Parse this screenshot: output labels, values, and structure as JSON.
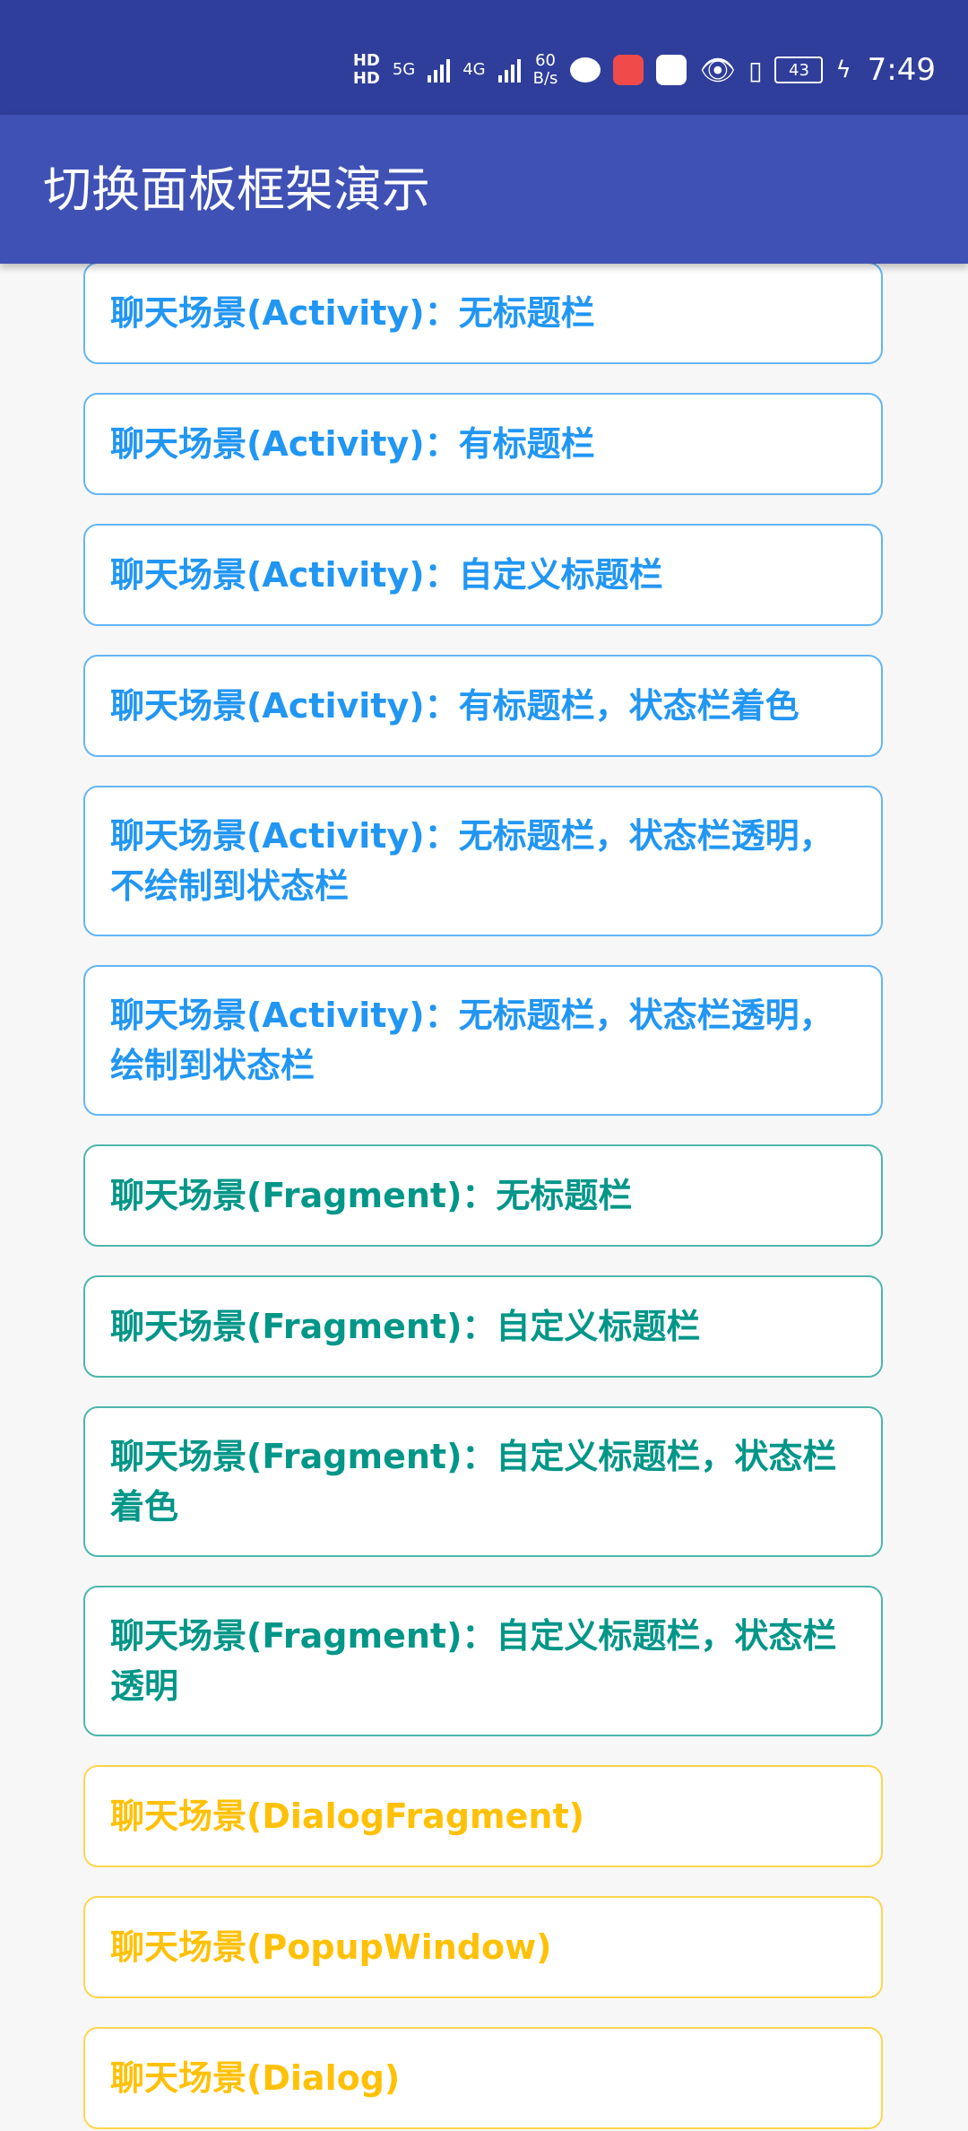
{
  "status_bar": {
    "hd_top": "HD",
    "hd_bottom": "HD",
    "net_5g": "5G",
    "net_4g": "4G",
    "speed_value": "60",
    "speed_unit": "B/s",
    "battery": "43",
    "time": "7:49",
    "icons": [
      "wechat-icon",
      "app-icon",
      "app-icon",
      "eye-icon",
      "vibrate-icon",
      "battery-icon",
      "charging-icon"
    ]
  },
  "app_bar": {
    "title": "切换面板框架演示"
  },
  "items": [
    {
      "label": "聊天场景(Activity)：无标题栏",
      "color": "#2196f3"
    },
    {
      "label": "聊天场景(Activity)：有标题栏",
      "color": "#2196f3"
    },
    {
      "label": "聊天场景(Activity)：自定义标题栏",
      "color": "#2196f3"
    },
    {
      "label": "聊天场景(Activity)：有标题栏，状态栏着色",
      "color": "#2196f3"
    },
    {
      "label": "聊天场景(Activity)：无标题栏，状态栏透明，不绘制到状态栏",
      "color": "#2196f3"
    },
    {
      "label": "聊天场景(Activity)：无标题栏，状态栏透明，绘制到状态栏",
      "color": "#2196f3"
    },
    {
      "label": "聊天场景(Fragment)：无标题栏",
      "color": "#009688"
    },
    {
      "label": "聊天场景(Fragment)：自定义标题栏",
      "color": "#009688"
    },
    {
      "label": "聊天场景(Fragment)：自定义标题栏，状态栏着色",
      "color": "#009688"
    },
    {
      "label": "聊天场景(Fragment)：自定义标题栏，状态栏透明",
      "color": "#009688"
    },
    {
      "label": "聊天场景(DialogFragment)",
      "color": "#ffc107"
    },
    {
      "label": "聊天场景(PopupWindow)",
      "color": "#ffc107"
    },
    {
      "label": "聊天场景(Dialog)",
      "color": "#ffc107"
    }
  ]
}
